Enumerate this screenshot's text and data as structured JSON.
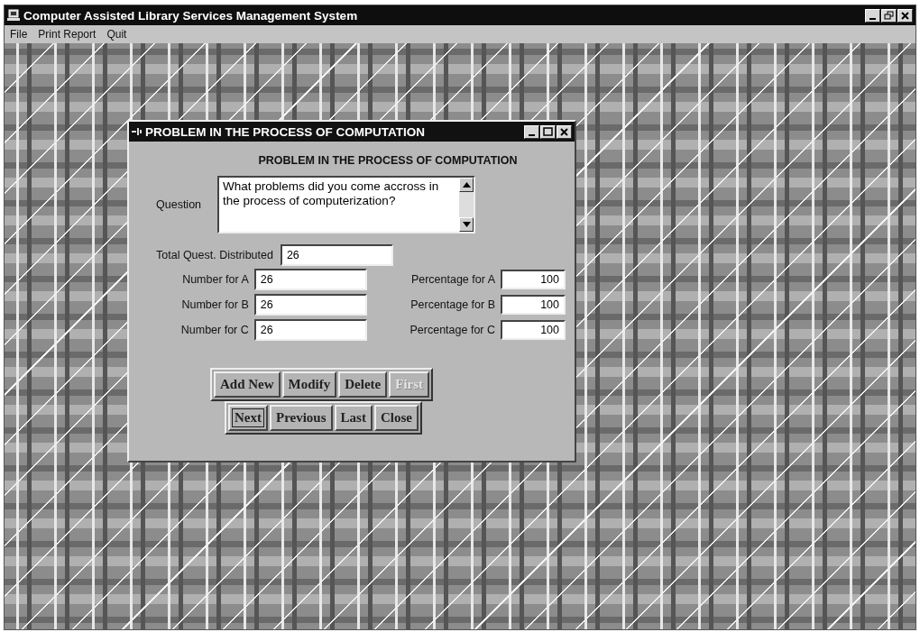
{
  "window": {
    "title": "Computer Assisted Library Services Management System"
  },
  "menu": [
    "File",
    "Print Report",
    "Quit"
  ],
  "dialog": {
    "title": "PROBLEM IN THE PROCESS OF COMPUTATION",
    "heading": "PROBLEM IN THE PROCESS OF COMPUTATION",
    "question": {
      "label": "Question",
      "value": "What problems did you come accross in the process of computerization?"
    },
    "total": {
      "label": "Total Quest. Distributed",
      "value": "26"
    },
    "numbers": [
      {
        "label": "Number for A",
        "value": "26"
      },
      {
        "label": "Number for B",
        "value": "26"
      },
      {
        "label": "Number for C",
        "value": "26"
      }
    ],
    "percentages": [
      {
        "label": "Percentage  for A",
        "value": "100"
      },
      {
        "label": "Percentage  for B",
        "value": "100"
      },
      {
        "label": "Percentage  for C",
        "value": "100"
      }
    ],
    "button_rows": [
      [
        {
          "label": "Add New",
          "disabled": false,
          "focused": false
        },
        {
          "label": "Modify",
          "disabled": false,
          "focused": false
        },
        {
          "label": "Delete",
          "disabled": false,
          "focused": false
        },
        {
          "label": "First",
          "disabled": true,
          "focused": false
        }
      ],
      [
        {
          "label": "Next",
          "disabled": false,
          "focused": true
        },
        {
          "label": "Previous",
          "disabled": false,
          "focused": false
        },
        {
          "label": "Last",
          "disabled": false,
          "focused": false
        },
        {
          "label": "Close",
          "disabled": false,
          "focused": false
        }
      ]
    ]
  }
}
